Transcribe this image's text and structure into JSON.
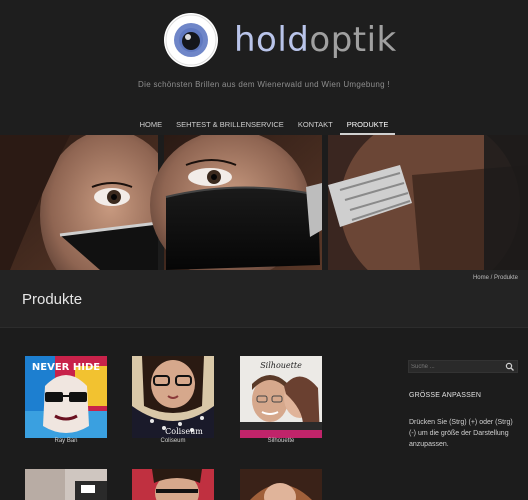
{
  "site": {
    "logo_part1": "hold",
    "logo_part2": "optik",
    "tagline": "Die schönsten Brillen aus dem Wienerwald und Wien Umgebung !"
  },
  "nav": {
    "items": [
      {
        "label": "HOME",
        "active": false
      },
      {
        "label": "SEHTEST & BRILLENSERVICE",
        "active": false
      },
      {
        "label": "KONTAKT",
        "active": false
      },
      {
        "label": "PRODUKTE",
        "active": true
      }
    ]
  },
  "breadcrumb": {
    "home": "Home",
    "separator": "/",
    "current": "Produkte"
  },
  "page": {
    "title": "Produkte"
  },
  "products": [
    {
      "label": "Ray Ban",
      "image_text": "NEVER HIDE"
    },
    {
      "label": "Coliseum",
      "image_text": "Coliseum"
    },
    {
      "label": "Silhouette",
      "image_text": "Silhouette"
    }
  ],
  "sidebar": {
    "search_placeholder": "Suche ...",
    "widget_title": "GRÖSSE ANPASSEN",
    "widget_text": "Drücken Sie (Strg) (+) oder (Strg) (-) um die größe der Darstellung anzupassen."
  },
  "colors": {
    "background": "#1c1c1c",
    "logo_accent": "#b9c4ea",
    "logo_grey": "#a0a0a0"
  }
}
